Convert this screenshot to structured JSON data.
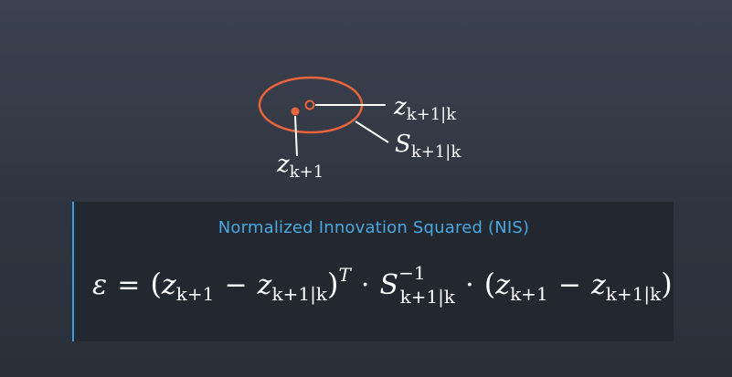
{
  "diagram": {
    "label_prediction": {
      "base": "z",
      "sub": "k+1|k"
    },
    "label_covariance": {
      "base": "S",
      "sub": "k+1|k"
    },
    "label_measurement": {
      "base": "z",
      "sub": "k+1"
    }
  },
  "panel": {
    "title": "Normalized Innovation Squared (NIS)",
    "formula": {
      "epsilon": "ε",
      "equals": "=",
      "open_paren": "(",
      "close_paren": ")",
      "z": "z",
      "sub_measure": "k+1",
      "minus": "−",
      "sub_predict": "k+1|k",
      "transpose": "T",
      "dot": "·",
      "S": "S",
      "sup_inverse": "−1",
      "sub_S": "k+1|k"
    }
  },
  "colors": {
    "ellipse": "#e8643c",
    "accent": "#3a9cd6",
    "text": "#ffffff"
  }
}
